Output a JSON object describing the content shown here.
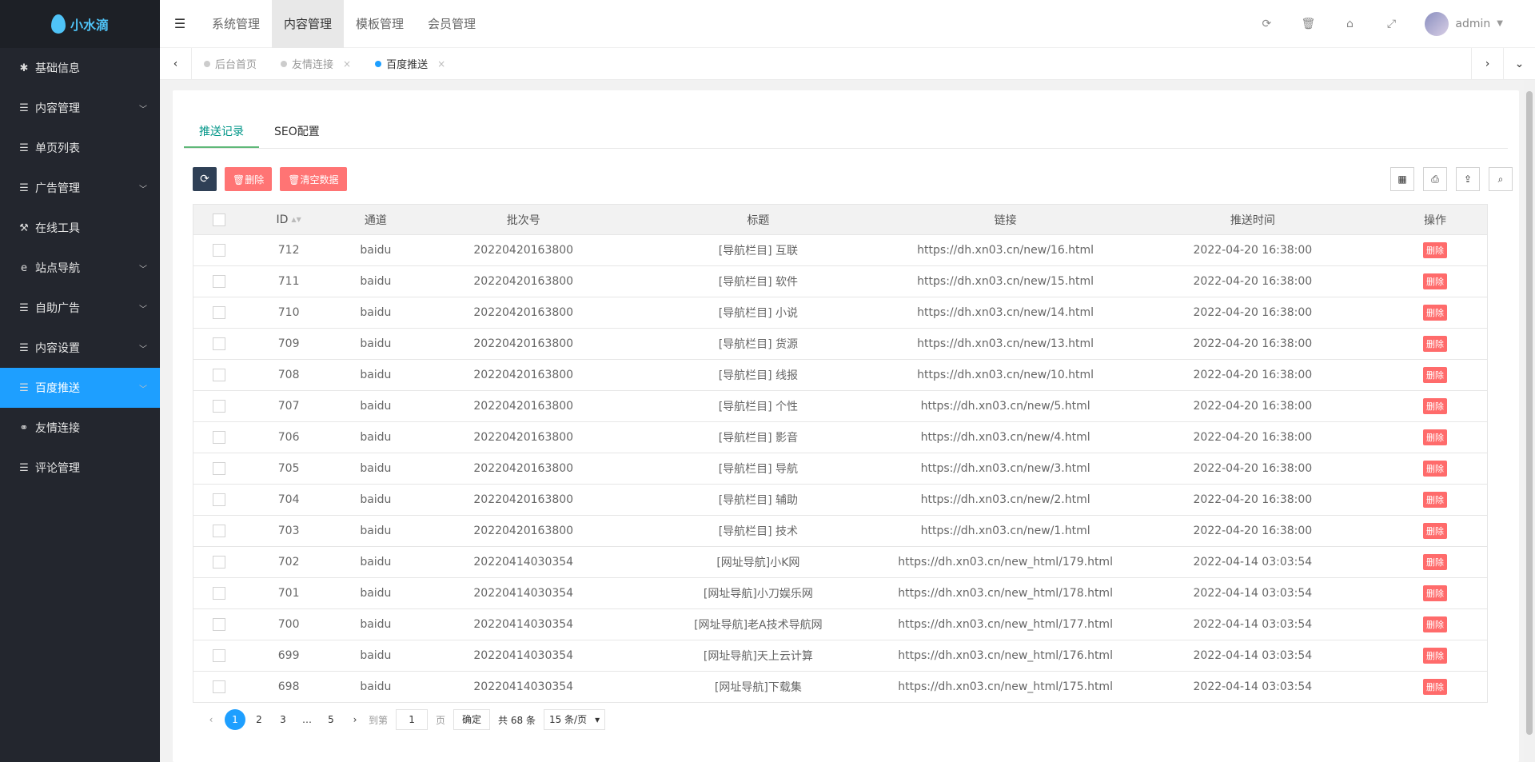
{
  "logo": {
    "text": "小水滴"
  },
  "sidebar": {
    "items": [
      {
        "label": "基础信息",
        "icon": "gear-icon",
        "glyph": "✱",
        "chevron": false
      },
      {
        "label": "内容管理",
        "icon": "list-icon",
        "glyph": "☰",
        "chevron": true
      },
      {
        "label": "单页列表",
        "icon": "list-icon",
        "glyph": "☰",
        "chevron": false
      },
      {
        "label": "广告管理",
        "icon": "list-icon",
        "glyph": "☰",
        "chevron": true
      },
      {
        "label": "在线工具",
        "icon": "hammer-icon",
        "glyph": "⚒",
        "chevron": false
      },
      {
        "label": "站点导航",
        "icon": "ie-icon",
        "glyph": "e",
        "chevron": true
      },
      {
        "label": "自助广告",
        "icon": "list-icon",
        "glyph": "☰",
        "chevron": true
      },
      {
        "label": "内容设置",
        "icon": "list-icon",
        "glyph": "☰",
        "chevron": true
      },
      {
        "label": "百度推送",
        "icon": "list-icon",
        "glyph": "☰",
        "chevron": true,
        "active": true
      },
      {
        "label": "友情连接",
        "icon": "link-icon",
        "glyph": "⚭",
        "chevron": false
      },
      {
        "label": "评论管理",
        "icon": "list-icon",
        "glyph": "☰",
        "chevron": false
      }
    ]
  },
  "header": {
    "nav": [
      "系统管理",
      "内容管理",
      "模板管理",
      "会员管理"
    ],
    "active_nav": 1,
    "user": "admin"
  },
  "tabs": [
    {
      "label": "后台首页",
      "close": false
    },
    {
      "label": "友情连接",
      "close": true
    },
    {
      "label": "百度推送",
      "close": true,
      "active": true
    }
  ],
  "subtabs": [
    "推送记录",
    "SEO配置"
  ],
  "toolbar": {
    "delete_label": "🗑删除",
    "clear_label": "🗑清空数据"
  },
  "table": {
    "columns": [
      "ID",
      "通道",
      "批次号",
      "标题",
      "链接",
      "推送时间",
      "操作"
    ],
    "action_label": "删除",
    "rows": [
      [
        "712",
        "baidu",
        "20220420163800",
        "[导航栏目] 互联",
        "https://dh.xn03.cn/new/16.html",
        "2022-04-20 16:38:00"
      ],
      [
        "711",
        "baidu",
        "20220420163800",
        "[导航栏目] 软件",
        "https://dh.xn03.cn/new/15.html",
        "2022-04-20 16:38:00"
      ],
      [
        "710",
        "baidu",
        "20220420163800",
        "[导航栏目] 小说",
        "https://dh.xn03.cn/new/14.html",
        "2022-04-20 16:38:00"
      ],
      [
        "709",
        "baidu",
        "20220420163800",
        "[导航栏目] 货源",
        "https://dh.xn03.cn/new/13.html",
        "2022-04-20 16:38:00"
      ],
      [
        "708",
        "baidu",
        "20220420163800",
        "[导航栏目] 线报",
        "https://dh.xn03.cn/new/10.html",
        "2022-04-20 16:38:00"
      ],
      [
        "707",
        "baidu",
        "20220420163800",
        "[导航栏目] 个性",
        "https://dh.xn03.cn/new/5.html",
        "2022-04-20 16:38:00"
      ],
      [
        "706",
        "baidu",
        "20220420163800",
        "[导航栏目] 影音",
        "https://dh.xn03.cn/new/4.html",
        "2022-04-20 16:38:00"
      ],
      [
        "705",
        "baidu",
        "20220420163800",
        "[导航栏目] 导航",
        "https://dh.xn03.cn/new/3.html",
        "2022-04-20 16:38:00"
      ],
      [
        "704",
        "baidu",
        "20220420163800",
        "[导航栏目] 辅助",
        "https://dh.xn03.cn/new/2.html",
        "2022-04-20 16:38:00"
      ],
      [
        "703",
        "baidu",
        "20220420163800",
        "[导航栏目] 技术",
        "https://dh.xn03.cn/new/1.html",
        "2022-04-20 16:38:00"
      ],
      [
        "702",
        "baidu",
        "20220414030354",
        "[网址导航]小K网",
        "https://dh.xn03.cn/new_html/179.html",
        "2022-04-14 03:03:54"
      ],
      [
        "701",
        "baidu",
        "20220414030354",
        "[网址导航]小刀娱乐网",
        "https://dh.xn03.cn/new_html/178.html",
        "2022-04-14 03:03:54"
      ],
      [
        "700",
        "baidu",
        "20220414030354",
        "[网址导航]老A技术导航网",
        "https://dh.xn03.cn/new_html/177.html",
        "2022-04-14 03:03:54"
      ],
      [
        "699",
        "baidu",
        "20220414030354",
        "[网址导航]天上云计算",
        "https://dh.xn03.cn/new_html/176.html",
        "2022-04-14 03:03:54"
      ],
      [
        "698",
        "baidu",
        "20220414030354",
        "[网址导航]下载集",
        "https://dh.xn03.cn/new_html/175.html",
        "2022-04-14 03:03:54"
      ]
    ]
  },
  "pager": {
    "pages": [
      "1",
      "2",
      "3",
      "…",
      "5"
    ],
    "current": "1",
    "goto_label": "到第",
    "goto_value": "1",
    "page_unit": "页",
    "confirm": "确定",
    "total": "共 68 条",
    "per_page": "15 条/页"
  },
  "colors": {
    "accent": "#1e9fff",
    "sidebar": "#23262e",
    "danger": "#ff5c5c",
    "tab_active": "#009688"
  }
}
